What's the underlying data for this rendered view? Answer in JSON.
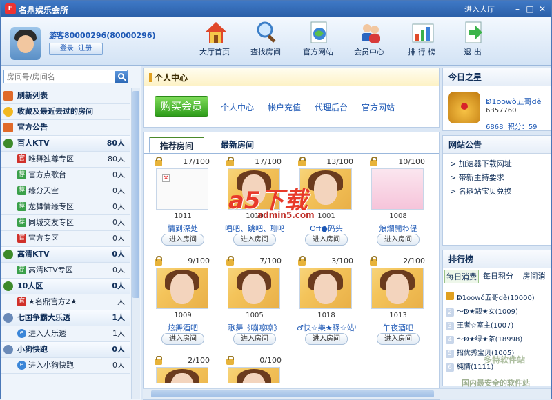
{
  "window": {
    "app_title": "名鼎娱乐会所",
    "logo_text": "F",
    "enter_hall": "进入大厅",
    "min": "–",
    "max": "□",
    "close": "✕"
  },
  "user": {
    "name": "游客80000296(80000296)",
    "login": "登录",
    "register": "注册"
  },
  "nav": [
    {
      "label": "大厅首页",
      "icon": "house-icon"
    },
    {
      "label": "查找房间",
      "icon": "magnifier-icon"
    },
    {
      "label": "官方网站",
      "icon": "web-page-icon"
    },
    {
      "label": "会员中心",
      "icon": "members-icon"
    },
    {
      "label": "排 行 榜",
      "icon": "ranking-chart-icon"
    },
    {
      "label": "退 出",
      "icon": "exit-arrow-icon"
    }
  ],
  "search": {
    "placeholder": "房间号/房间名"
  },
  "tree": [
    {
      "kind": "top",
      "label": "刷新列表",
      "count": ""
    },
    {
      "kind": "top",
      "label": "收藏及最近去过的房间",
      "count": ""
    },
    {
      "kind": "top",
      "label": "官方公告",
      "count": ""
    },
    {
      "kind": "cat",
      "label": "百人KTV",
      "count": "80人"
    },
    {
      "kind": "sub",
      "badge": "官",
      "label": "唯舞独尊专区",
      "count": "80人"
    },
    {
      "kind": "sub",
      "badge": "荐",
      "label": "官方点歌台",
      "count": "0人"
    },
    {
      "kind": "sub",
      "badge": "荐",
      "label": "缘分天空",
      "count": "0人"
    },
    {
      "kind": "sub",
      "badge": "荐",
      "label": "龙舞情缘专区",
      "count": "0人"
    },
    {
      "kind": "sub",
      "badge": "荐",
      "label": "同城交友专区",
      "count": "0人"
    },
    {
      "kind": "sub",
      "badge": "官",
      "label": "官方专区",
      "count": "0人"
    },
    {
      "kind": "cat",
      "label": "高清KTV",
      "count": "0人"
    },
    {
      "kind": "sub",
      "badge": "荐",
      "label": "高清KTV专区",
      "count": "0人"
    },
    {
      "kind": "cat",
      "label": "10人区",
      "count": "0人"
    },
    {
      "kind": "sub",
      "badge": "官",
      "label": "★名鼎官方2★",
      "count": "人"
    },
    {
      "kind": "cat",
      "label": "七国争霸大乐透",
      "count": "1人"
    },
    {
      "kind": "sub",
      "badge": "e",
      "label": "进入大乐透",
      "count": "1人"
    },
    {
      "kind": "cat",
      "label": "小狗快跑",
      "count": "0人"
    },
    {
      "kind": "sub",
      "badge": "e",
      "label": "进入小狗快跑",
      "count": "0人"
    }
  ],
  "personal": {
    "title": "个人中心",
    "buy_button": "购买会员",
    "links": [
      "个人中心",
      "帐户充值",
      "代理后台",
      "官方网站"
    ]
  },
  "rooms": {
    "tab_recommended": "推荐房间",
    "tab_latest": "最新房间",
    "enter_label": "进入房间",
    "cards": [
      {
        "occupancy": "17/100",
        "id": "1011",
        "name": "情到深处",
        "thumb": "broken"
      },
      {
        "occupancy": "17/100",
        "id": "1010",
        "name": "唱吧、跳吧、聊吧",
        "thumb": "girl"
      },
      {
        "occupancy": "13/100",
        "id": "1001",
        "name": "Off●码头",
        "thumb": "girl"
      },
      {
        "occupancy": "10/100",
        "id": "1008",
        "name": "烺爛開わ偍",
        "thumb": "pink"
      },
      {
        "occupancy": "9/100",
        "id": "1009",
        "name": "炫舞酒吧",
        "thumb": "girl"
      },
      {
        "occupancy": "7/100",
        "id": "1005",
        "name": "歌舞《嘣嚓嚓》",
        "thumb": "girl"
      },
      {
        "occupancy": "3/100",
        "id": "1018",
        "name": "♂快☆樂★驛☆站♀",
        "thumb": "girl"
      },
      {
        "occupancy": "2/100",
        "id": "1013",
        "name": "午夜酒吧",
        "thumb": "girl"
      },
      {
        "occupancy": "2/100",
        "id": "",
        "name": "",
        "thumb": "girl"
      },
      {
        "occupancy": "0/100",
        "id": "",
        "name": "",
        "thumb": "girl"
      }
    ]
  },
  "star": {
    "title": "今日之星",
    "name": "ↁ1oowǒ五哥dě",
    "id": "6357760",
    "level": "6868",
    "score_label": "积分：",
    "score": "59"
  },
  "notice": {
    "title": "网站公告",
    "items": [
      "> 加速器下载网址",
      "> 带新主持要求",
      "> 名鼎站宝贝兑换"
    ]
  },
  "ranking": {
    "title": "排行榜",
    "tabs": [
      "每日消费",
      "每日积分",
      "房间消"
    ],
    "rows": [
      {
        "n": "",
        "text": "ↁ1oowǒ五哥dě(10000)"
      },
      {
        "n": "2",
        "text": "〜ↁ★靓★女(1009)"
      },
      {
        "n": "3",
        "text": "王者☆室主(1007)"
      },
      {
        "n": "4",
        "text": "〜ↁ★绿★茶(18998)"
      },
      {
        "n": "5",
        "text": "招优秀宝贝(1005)"
      },
      {
        "n": "6",
        "text": "純情(1111)"
      }
    ]
  },
  "watermark": {
    "logo": "a5下载",
    "url": "admin5.com",
    "site": "多特软件站",
    "site2": "国内最安全的软件站"
  }
}
